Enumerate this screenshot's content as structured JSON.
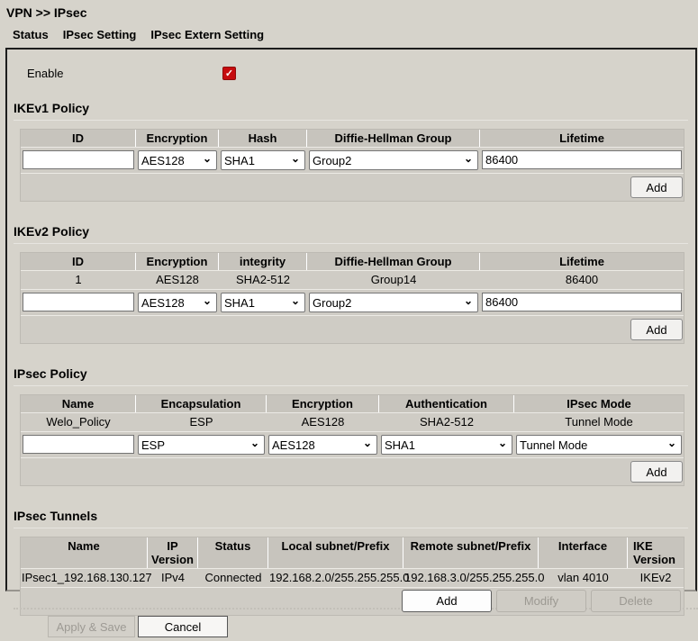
{
  "page": {
    "title": "VPN >> IPsec"
  },
  "tabs": [
    {
      "label": "Status"
    },
    {
      "label": "IPsec Setting"
    },
    {
      "label": "IPsec Extern Setting"
    }
  ],
  "icons": {
    "checkbox_check": "✓",
    "select_chevron": "⌄"
  },
  "colors": {
    "checkbox_red": "#c60b0e",
    "page_bg": "#d6d3cb",
    "table_header_bg": "#c7c4bd"
  },
  "enable": {
    "label": "Enable",
    "checked": true
  },
  "ikev1": {
    "title": "IKEv1 Policy",
    "headers": [
      "ID",
      "Encryption",
      "Hash",
      "Diffie-Hellman Group",
      "Lifetime"
    ],
    "form": {
      "id_value": "",
      "encryption": "AES128",
      "hash": "SHA1",
      "dh_group": "Group2",
      "lifetime": "86400"
    },
    "add_label": "Add"
  },
  "ikev2": {
    "title": "IKEv2 Policy",
    "headers": [
      "ID",
      "Encryption",
      "integrity",
      "Diffie-Hellman Group",
      "Lifetime"
    ],
    "rows": [
      [
        "1",
        "AES128",
        "SHA2-512",
        "Group14",
        "86400"
      ]
    ],
    "form": {
      "id_value": "",
      "encryption": "AES128",
      "integrity": "SHA1",
      "dh_group": "Group2",
      "lifetime": "86400"
    },
    "add_label": "Add"
  },
  "ipsec_policy": {
    "title": "IPsec Policy",
    "headers": [
      "Name",
      "Encapsulation",
      "Encryption",
      "Authentication",
      "IPsec Mode"
    ],
    "rows": [
      [
        "Welo_Policy",
        "ESP",
        "AES128",
        "SHA2-512",
        "Tunnel Mode"
      ]
    ],
    "form": {
      "name_value": "",
      "encapsulation": "ESP",
      "encryption": "AES128",
      "authentication": "SHA1",
      "mode": "Tunnel Mode"
    },
    "add_label": "Add"
  },
  "tunnels": {
    "title": "IPsec Tunnels",
    "headers": [
      "Name",
      "IP Version",
      "Status",
      "Local subnet/Prefix",
      "Remote subnet/Prefix",
      "Interface",
      "IKE Version"
    ],
    "rows": [
      [
        "IPsec1_192.168.130.127",
        "IPv4",
        "Connected",
        "192.168.2.0/255.255.255.0",
        "192.168.3.0/255.255.255.0",
        "vlan 4010",
        "IKEv2"
      ]
    ],
    "buttons": {
      "add": "Add",
      "modify": "Modify",
      "delete": "Delete"
    }
  },
  "footer": {
    "apply": "Apply & Save",
    "cancel": "Cancel"
  }
}
